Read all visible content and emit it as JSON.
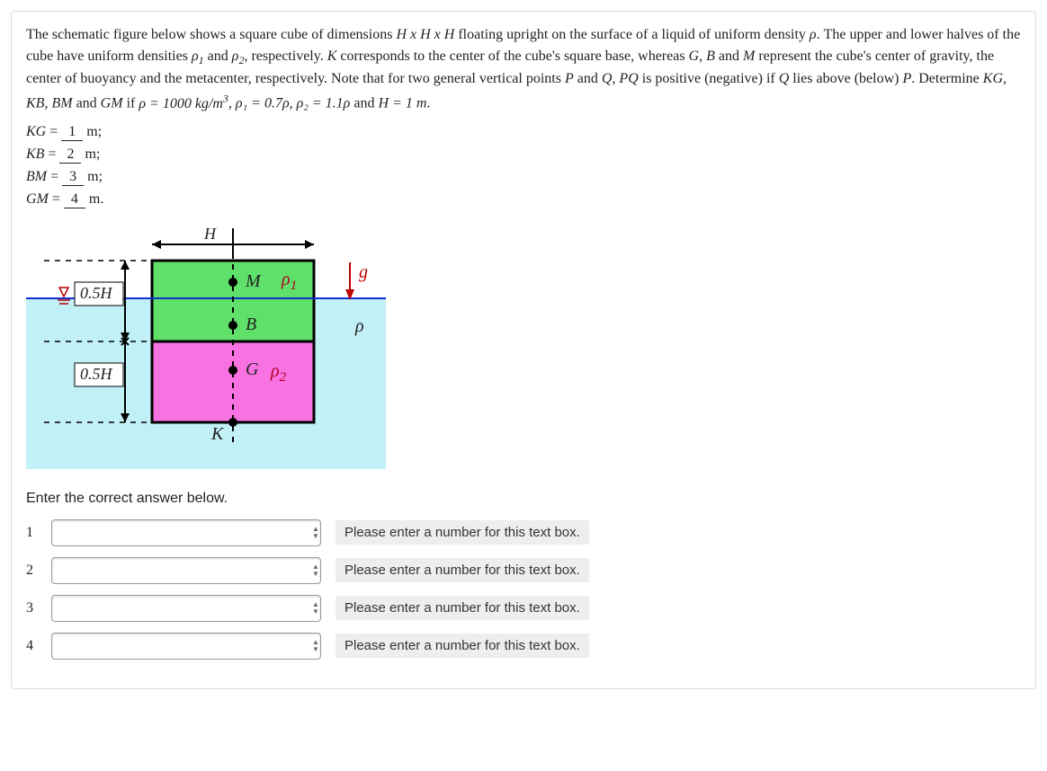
{
  "prompt": {
    "p1a": "The schematic figure below shows a square cube of dimensions ",
    "p1b": " floating upright on the surface of a liquid of uniform density ",
    "p1c": ". The upper and lower halves of the cube have uniform densities ",
    "p1d": " and ",
    "p1e": ", respectively. ",
    "p1f": " corresponds to the center of the cube's square base, whereas ",
    "p1g": " and ",
    "p1h": " represent the cube's center of gravity, the center of buoyancy and the metacenter, respectively. Note that for two general vertical points ",
    "p1i": " and ",
    "p1j": ", ",
    "p1k": " is positive (negative) if ",
    "p1l": " lies above (below) ",
    "p1m": ". Determine ",
    "p1n": " and ",
    "p1o": " if ",
    "rho_val": "ρ = 1000 kg/m",
    "rho1_val": "ρ₁ = 0.7ρ",
    "rho2_val": "ρ₂ = 1.1ρ",
    "h_val": "H = 1 m",
    "dims": "H x H x H"
  },
  "symbols": {
    "rho": "ρ",
    "rho1": "ρ",
    "rho2": "ρ",
    "K": "K",
    "G": "G",
    "B": "B",
    "M": "M",
    "P": "P",
    "Q": "Q",
    "PQ": "PQ",
    "KG": "KG",
    "KB": "KB",
    "BM": "BM",
    "GM": "GM"
  },
  "blanks": {
    "kg": {
      "label": "KG",
      "val": "1",
      "unit": "m;"
    },
    "kb": {
      "label": "KB",
      "val": "2",
      "unit": "m;"
    },
    "bm": {
      "label": "BM",
      "val": "3",
      "unit": "m;"
    },
    "gm": {
      "label": "GM",
      "val": "4",
      "unit": "m."
    }
  },
  "figure": {
    "H": "H",
    "half1": "0.5H",
    "half2": "0.5H",
    "M": "M",
    "B": "B",
    "G": "G",
    "K": "K",
    "rho1": "ρ",
    "rho2": "ρ",
    "rho": "ρ",
    "g": "g"
  },
  "enter_heading": "Enter the correct answer below.",
  "inputs": {
    "r1": {
      "label": "1",
      "warn": "Please enter a number for this text box."
    },
    "r2": {
      "label": "2",
      "warn": "Please enter a number for this text box."
    },
    "r3": {
      "label": "3",
      "warn": "Please enter a number for this text box."
    },
    "r4": {
      "label": "4",
      "warn": "Please enter a number for this text box."
    }
  }
}
